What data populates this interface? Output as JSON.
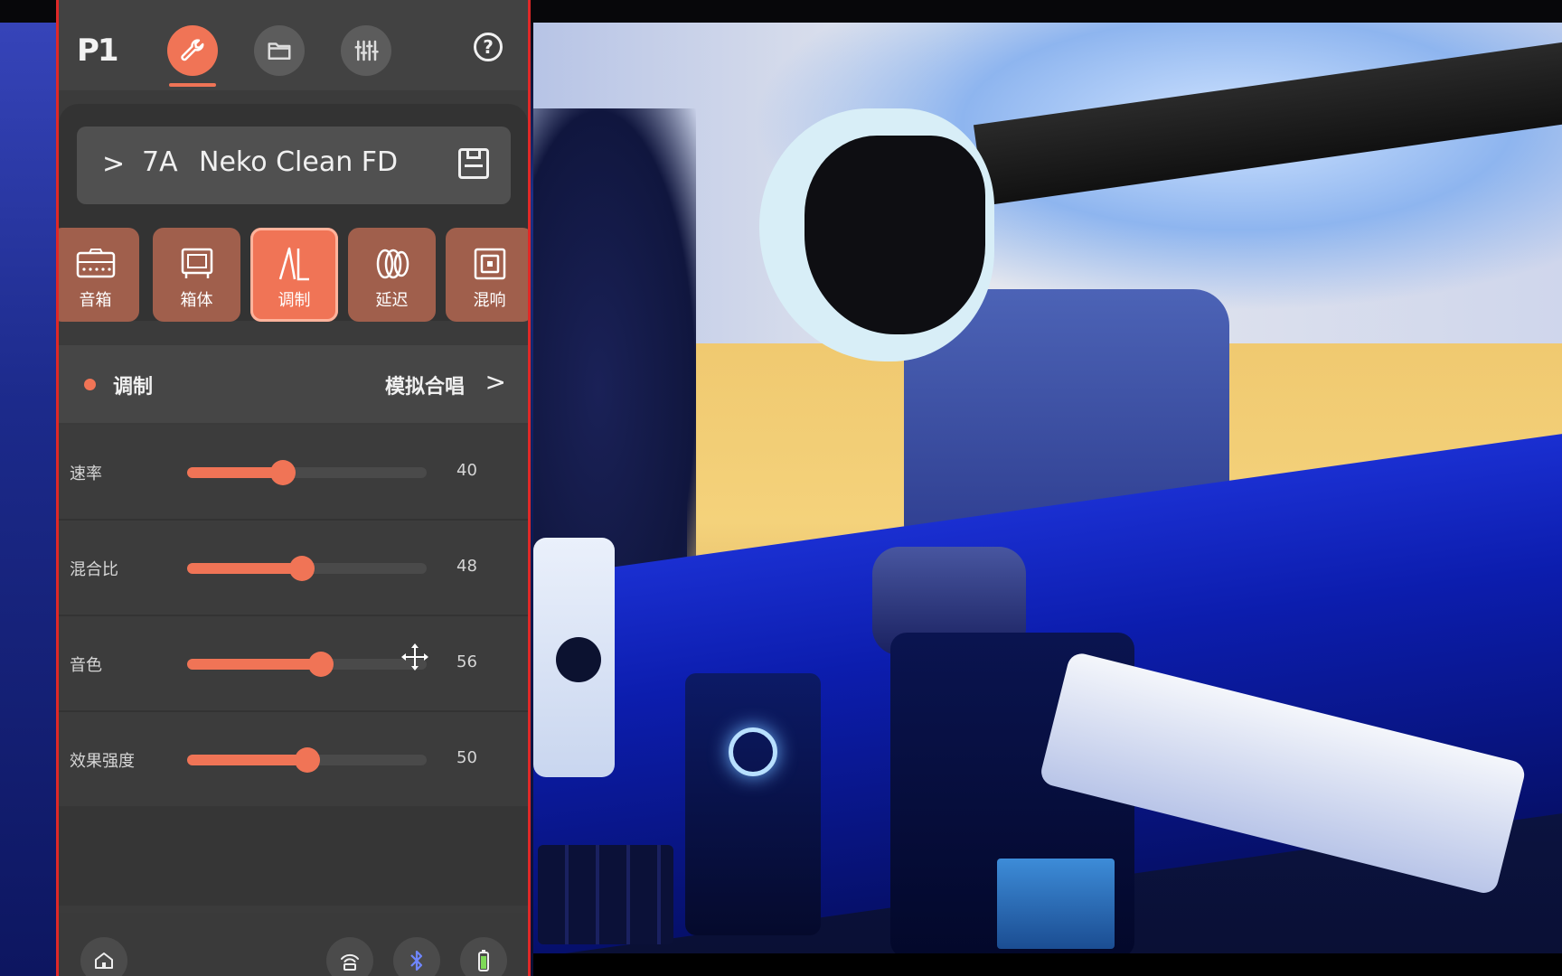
{
  "app": {
    "logo": "P1",
    "nav": {
      "items": [
        {
          "name": "wrench",
          "active": true
        },
        {
          "name": "folder",
          "active": false
        },
        {
          "name": "mixer",
          "active": false
        }
      ],
      "help_label": "?"
    },
    "preset": {
      "chevron": ">",
      "code": "7A",
      "name": "Neko Clean FD",
      "save_icon": "save-icon"
    },
    "modules": [
      {
        "label": "音箱",
        "icon": "amp-icon",
        "active": false
      },
      {
        "label": "箱体",
        "icon": "cabinet-icon",
        "active": false
      },
      {
        "label": "调制",
        "icon": "modulation-icon",
        "active": true
      },
      {
        "label": "延迟",
        "icon": "delay-icon",
        "active": false
      },
      {
        "label": "混响",
        "icon": "reverb-icon",
        "active": false
      }
    ],
    "section": {
      "title": "调制",
      "value": "模拟合唱",
      "chevron": ">"
    },
    "params": [
      {
        "label": "速率",
        "value": "40",
        "fraction": 0.4
      },
      {
        "label": "混合比",
        "value": "48",
        "fraction": 0.48
      },
      {
        "label": "音色",
        "value": "56",
        "fraction": 0.56
      },
      {
        "label": "效果强度",
        "value": "50",
        "fraction": 0.5
      }
    ],
    "bottombar": {
      "icons": [
        "home-icon",
        "wireless-icon",
        "bluetooth-icon",
        "battery-icon"
      ]
    }
  },
  "colors": {
    "accent": "#f07456",
    "module_inactive": "#a05f4c",
    "panel": "#3b3b3b",
    "border": "#e02828"
  }
}
